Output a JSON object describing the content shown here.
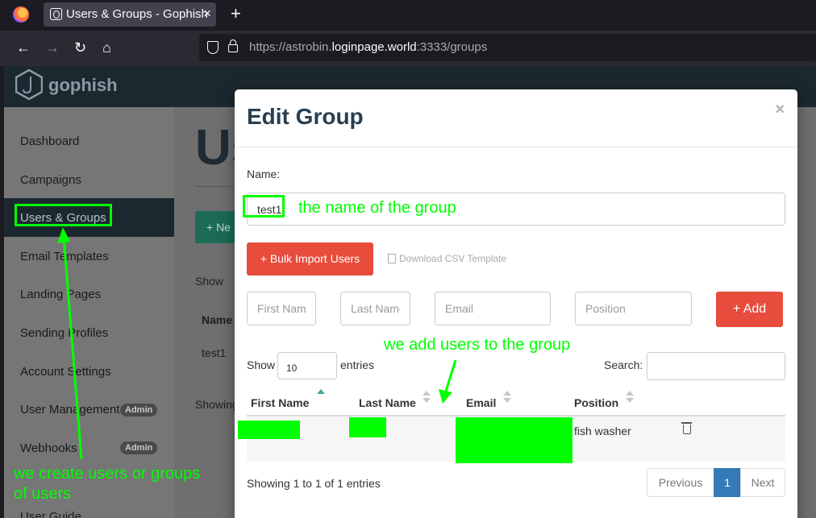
{
  "browser": {
    "tab_title": "Users & Groups - Gophish",
    "tab_close": "×",
    "new_tab": "+",
    "url_prefix": "https://astrobin.",
    "url_domain": "loginpage.world",
    "url_suffix": ":3333/groups"
  },
  "app": {
    "brand": "gophish",
    "sidebar": [
      {
        "label": "Dashboard"
      },
      {
        "label": "Campaigns"
      },
      {
        "label": "Users & Groups",
        "active": true
      },
      {
        "label": "Email Templates"
      },
      {
        "label": "Landing Pages"
      },
      {
        "label": "Sending Profiles"
      },
      {
        "label": "Account Settings"
      },
      {
        "label": "User Management",
        "badge": "Admin"
      },
      {
        "label": "Webhooks",
        "badge": "Admin"
      },
      {
        "label": "User Guide"
      }
    ],
    "behind": {
      "title": "Us",
      "new_btn": "+ Ne",
      "show": "Show",
      "col_name": "Name",
      "row_name": "test1",
      "showing": "Showing"
    }
  },
  "modal": {
    "title": "Edit Group",
    "close": "×",
    "name_label": "Name:",
    "name_value": "test1",
    "bulk_import": "+ Bulk Import Users",
    "download_csv": "Download CSV Template",
    "first_name_ph": "First Name",
    "last_name_ph": "Last Name",
    "email_ph": "Email",
    "position_ph": "Position",
    "add_btn": "+ Add",
    "show_label": "Show",
    "entries_value": "10",
    "entries_label": "entries",
    "search_label": "Search:",
    "columns": [
      "First Name",
      "Last Name",
      "Email",
      "Position"
    ],
    "rows": [
      {
        "first_name": "",
        "last_name": "",
        "email": "",
        "position": "fish washer"
      }
    ],
    "showing": "Showing 1 to 1 of 1 entries",
    "pagination": {
      "previous": "Previous",
      "page": "1",
      "next": "Next"
    }
  },
  "annotations": {
    "name_note": "the name of the group",
    "users_note": "we add users to the group",
    "groups_note_line1": "we create users or groups",
    "groups_note_line2": "of users",
    "color": "#00ff00"
  }
}
